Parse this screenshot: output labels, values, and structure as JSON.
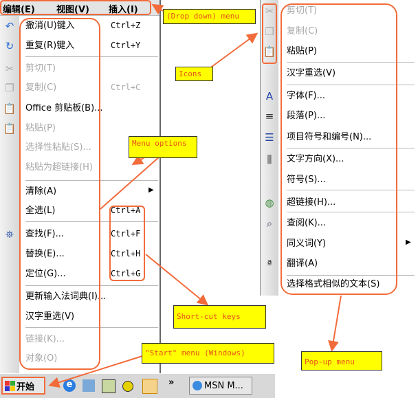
{
  "menubar": {
    "items": [
      "编辑(E)",
      "视图(V)",
      "插入(I)"
    ]
  },
  "edit_menu": {
    "items": [
      {
        "label": "撤消(U)键入",
        "shortcut": "Ctrl+Z",
        "icon": "undo-icon",
        "disabled": false
      },
      {
        "label": "重复(R)键入",
        "shortcut": "Ctrl+Y",
        "icon": "redo-icon",
        "disabled": false
      },
      {
        "label": "剪切(T)",
        "shortcut": "",
        "icon": "cut-icon",
        "disabled": true
      },
      {
        "label": "复制(C)",
        "shortcut": "Ctrl+C",
        "icon": "copy-icon",
        "disabled": true
      },
      {
        "label": "Office 剪贴板(B)...",
        "shortcut": "",
        "icon": "clipboard-icon",
        "disabled": false
      },
      {
        "label": "粘贴(P)",
        "shortcut": "",
        "icon": "paste-icon",
        "disabled": true
      },
      {
        "label": "选择性粘贴(S)...",
        "shortcut": "",
        "icon": "",
        "disabled": true
      },
      {
        "label": "粘贴为超链接(H)",
        "shortcut": "",
        "icon": "",
        "disabled": true
      },
      {
        "label": "清除(A)",
        "shortcut": "",
        "icon": "",
        "disabled": false,
        "submenu": true
      },
      {
        "label": "全选(L)",
        "shortcut": "Ctrl+A",
        "icon": "",
        "disabled": false
      },
      {
        "label": "查找(F)...",
        "shortcut": "Ctrl+F",
        "icon": "binoculars-icon",
        "disabled": false
      },
      {
        "label": "替换(E)...",
        "shortcut": "Ctrl+H",
        "icon": "",
        "disabled": false
      },
      {
        "label": "定位(G)...",
        "shortcut": "Ctrl+G",
        "icon": "",
        "disabled": false
      },
      {
        "label": "更新输入法词典(I)...",
        "shortcut": "",
        "icon": "",
        "disabled": false
      },
      {
        "label": "汉字重选(V)",
        "shortcut": "",
        "icon": "",
        "disabled": false
      },
      {
        "label": "链接(K)...",
        "shortcut": "",
        "icon": "",
        "disabled": true
      },
      {
        "label": "对象(O)",
        "shortcut": "",
        "icon": "",
        "disabled": true
      }
    ]
  },
  "popup_menu": {
    "items": [
      {
        "label": "剪切(T)",
        "icon": "cut-icon",
        "disabled": true
      },
      {
        "label": "复制(C)",
        "icon": "copy-icon",
        "disabled": true
      },
      {
        "label": "粘贴(P)",
        "icon": "paste-icon",
        "disabled": false
      },
      {
        "label": "汉字重选(V)",
        "icon": "",
        "disabled": false
      },
      {
        "label": "字体(F)...",
        "icon": "font-icon",
        "disabled": false
      },
      {
        "label": "段落(P)...",
        "icon": "paragraph-icon",
        "disabled": false
      },
      {
        "label": "项目符号和编号(N)...",
        "icon": "bullets-icon",
        "disabled": false
      },
      {
        "label": "文字方向(X)...",
        "icon": "text-direction-icon",
        "disabled": false
      },
      {
        "label": "符号(S)...",
        "icon": "",
        "disabled": false
      },
      {
        "label": "超链接(H)...",
        "icon": "hyperlink-icon",
        "disabled": false
      },
      {
        "label": "查阅(K)...",
        "icon": "research-icon",
        "disabled": false
      },
      {
        "label": "同义词(Y)",
        "icon": "",
        "disabled": false,
        "submenu": true
      },
      {
        "label": "翻译(A)",
        "icon": "translate-icon",
        "disabled": false
      },
      {
        "label": "选择格式相似的文本(S)",
        "icon": "",
        "disabled": false
      }
    ]
  },
  "taskbar": {
    "start_label": "开始",
    "chevron": "»",
    "msn_label": "MSN M..."
  },
  "annotations": {
    "dropdown": "(Drop down) menu",
    "icons": "Icons",
    "menu_options": "Menu options",
    "shortcut_keys": "Short-cut keys",
    "start_menu": "\"Start\" menu (Windows)",
    "popup_menu": "Pop-up menu"
  },
  "colors": {
    "annotation_fill": "#ffff00",
    "annotation_text": "#e8501c",
    "highlight": "#f26b3a"
  }
}
